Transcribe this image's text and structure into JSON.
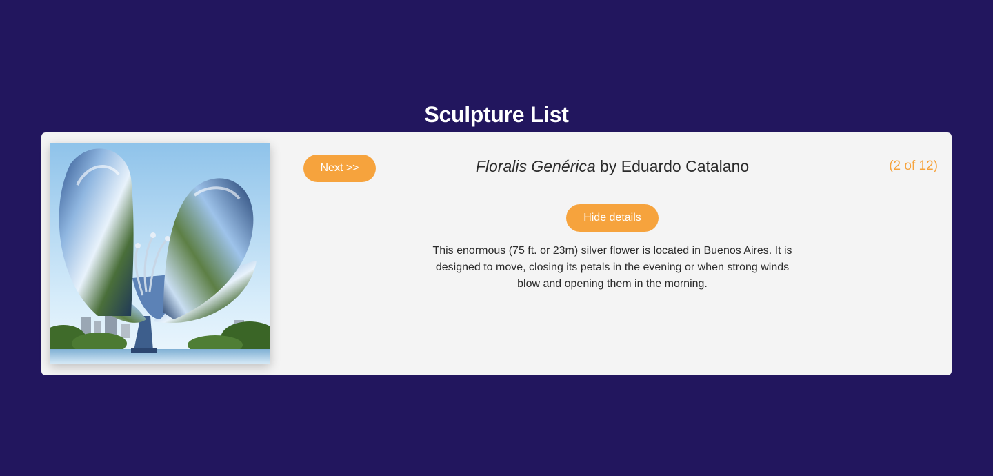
{
  "page": {
    "title": "Sculpture List"
  },
  "sculpture": {
    "name": "Floralis Genérica",
    "artist_prefix": " by ",
    "artist": "Eduardo Catalano",
    "counter": "(2 of 12)",
    "description": "This enormous (75 ft. or 23m) silver flower is located in Buenos Aires. It is designed to move, closing its petals in the evening or when strong winds blow and opening them in the morning.",
    "image_subject": "metal-flower-sculpture"
  },
  "controls": {
    "next_label": "Next >>",
    "hide_details_label": "Hide details"
  },
  "colors": {
    "background": "#22165e",
    "card": "#f4f4f4",
    "accent": "#f6a33d",
    "text": "#2b2b2b"
  }
}
